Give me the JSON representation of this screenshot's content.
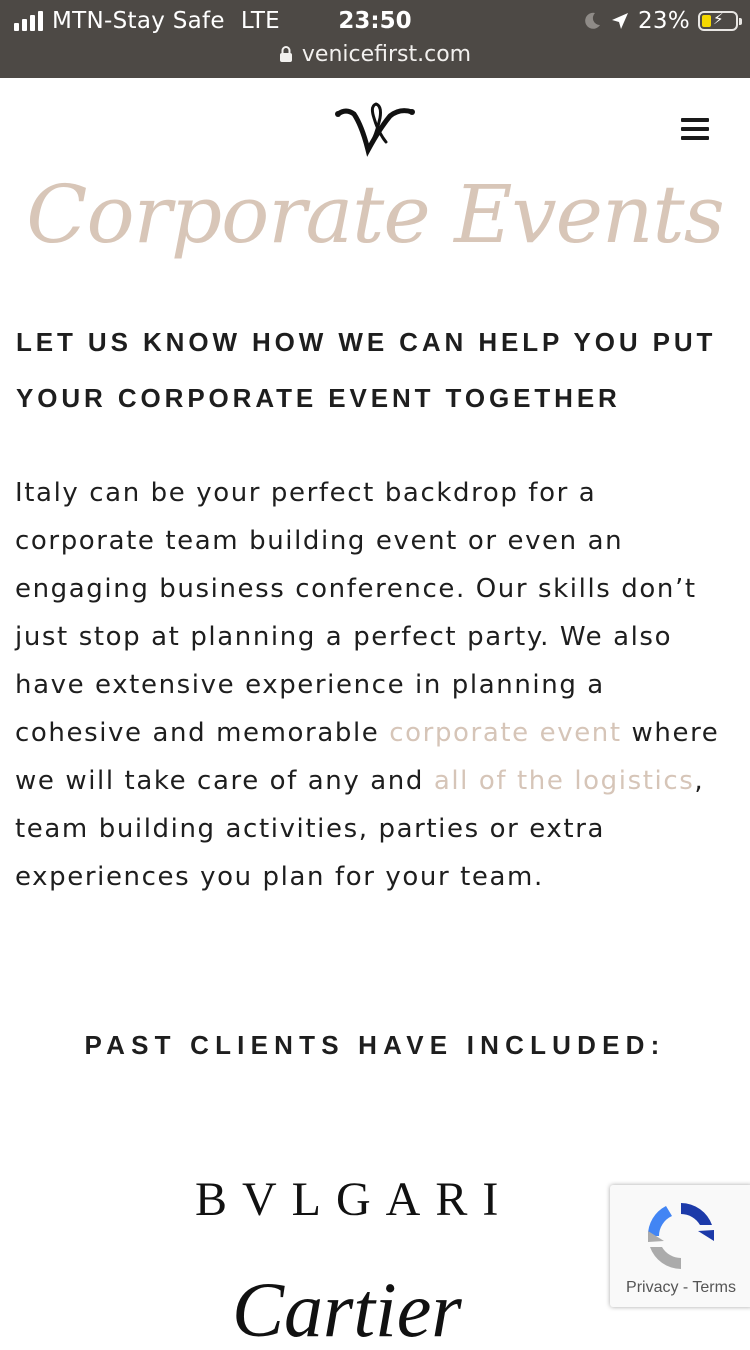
{
  "status_bar": {
    "carrier": "MTN-Stay Safe",
    "network": "LTE",
    "time": "23:50",
    "battery": "23%",
    "battery_level": 0.23,
    "url": "venicefirst.com"
  },
  "header": {
    "logo_icon": "vf-monogram-icon",
    "menu_icon": "hamburger-menu-icon"
  },
  "page": {
    "script_title": "Corporate Events",
    "heading_line1": "LET US KNOW HOW WE CAN HELP YOU PUT",
    "heading_line2": "YOUR CORPORATE EVENT TOGETHER",
    "intro": {
      "text_1": "Italy can be your perfect backdrop for a corporate team building event or even an engaging business conference. Our skills don’t just stop at planning a perfect party. We also have extensive experience in planning a cohesive and memorable ",
      "link_1": "corporate event",
      "text_2": " where we will take care of any and ",
      "link_2": "all of the logistics",
      "text_3": ", team building activities, parties or extra experiences you plan for your team."
    },
    "clients_heading": "PAST CLIENTS HAVE INCLUDED:",
    "clients": [
      "BVLGARI",
      "Cartier"
    ]
  },
  "recaptcha": {
    "privacy": "Privacy",
    "separator": "-",
    "terms": "Terms"
  },
  "colors": {
    "status_bar_bg": "#4d4945",
    "accent_beige": "#d6c5b8",
    "text": "#1e1e1e",
    "recaptcha_blue": "#1c3aa9"
  }
}
